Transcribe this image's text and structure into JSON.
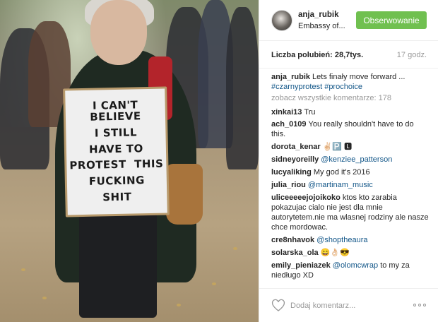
{
  "photo": {
    "sign_lines": [
      "I CAN'T BELIEVE",
      "I STILL",
      "HAVE TO",
      "PROTEST  THIS",
      "FUCKING",
      "SHIT"
    ]
  },
  "header": {
    "username": "anja_rubik",
    "location": "Embassy of...",
    "follow_label": "Obserwowanie",
    "follow_color": "#70c050"
  },
  "stats": {
    "likes": "Liczba polubień: 28,7tys.",
    "time": "17 godz."
  },
  "caption": {
    "user": "anja_rubik",
    "text": "Lets finały move forward ...",
    "hashtags": "#czarnyprotest #prochoice"
  },
  "more_comments": "zobacz wszystkie komentarze: 178",
  "comments": [
    {
      "user": "xinkai13",
      "text": "Tru",
      "mention": ""
    },
    {
      "user": "ach_0109",
      "text": "You really shouldn't have to do this.",
      "mention": ""
    },
    {
      "user": "dorota_kenar",
      "text": "✌🏻🅿️ 🅻",
      "mention": ""
    },
    {
      "user": "sidneyoreilly",
      "text": "",
      "mention": "@kenziee_patterson"
    },
    {
      "user": "lucyaliking",
      "text": "My god it's 2016",
      "mention": ""
    },
    {
      "user": "julia_riou",
      "text": "",
      "mention": "@martinam_music"
    },
    {
      "user": "uliceeeeejojoikoko",
      "text": "ktos kto zarabia pokazujac cialo nie jest dla mnie autorytetem.nie ma wlasnej rodziny ale nasze chce mordowac.",
      "mention": ""
    },
    {
      "user": "cre8nhavok",
      "text": "",
      "mention": "@shoptheaura"
    },
    {
      "user": "solarska_ola",
      "text": "😄👌🏻😎",
      "mention": ""
    },
    {
      "user": "emily_pieniazek",
      "text": "to my za niedługo XD",
      "mention": "@olomcwrap"
    }
  ],
  "footer": {
    "comment_placeholder": "Dodaj komentarz...",
    "heart_icon": "heart-outline-icon",
    "more_icon": "more-options-icon"
  },
  "colors": {
    "link": "#125688",
    "muted": "#999999",
    "text": "#262626"
  }
}
